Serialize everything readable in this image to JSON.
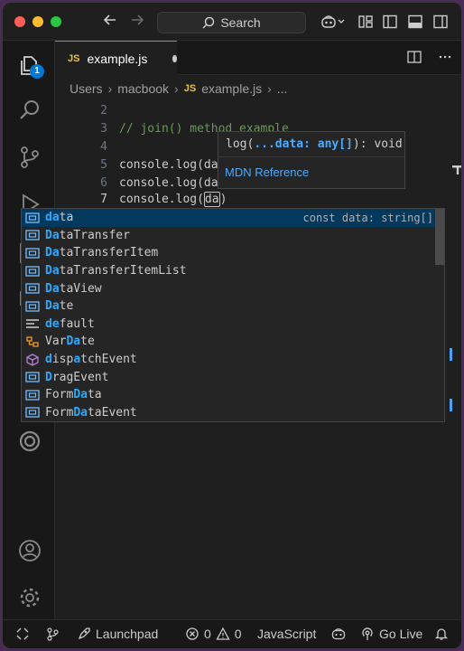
{
  "titlebar": {
    "search_label": "Search",
    "back_icon": "arrow-left-icon",
    "forward_icon": "arrow-right-icon"
  },
  "activity": {
    "explorer_badge": "1"
  },
  "tab": {
    "js_badge": "JS",
    "filename": "example.js"
  },
  "breadcrumb": {
    "items": [
      "Users",
      "macbook",
      "example.js",
      "..."
    ],
    "js_badge": "JS"
  },
  "editor": {
    "lines": [
      {
        "num": "2",
        "text": ""
      },
      {
        "num": "3",
        "text": "// join() method example"
      },
      {
        "num": "4",
        "text": ""
      },
      {
        "num": "5",
        "text": "console.log(da"
      },
      {
        "num": "6",
        "text": "console.log(da"
      },
      {
        "num": "7",
        "text": "console.log(da)"
      }
    ]
  },
  "signature": {
    "prefix": "log(",
    "param": "...data: any[]",
    "suffix": "): void",
    "link": "MDN Reference"
  },
  "suggestions": [
    {
      "pre": "",
      "hl": "da",
      "post": "ta",
      "icon": "variable-icon",
      "detail": "const data: string[]",
      "selected": true
    },
    {
      "pre": "",
      "hl": "Da",
      "post": "taTransfer",
      "icon": "variable-icon"
    },
    {
      "pre": "",
      "hl": "Da",
      "post": "taTransferItem",
      "icon": "variable-icon"
    },
    {
      "pre": "",
      "hl": "Da",
      "post": "taTransferItemList",
      "icon": "variable-icon"
    },
    {
      "pre": "",
      "hl": "Da",
      "post": "taView",
      "icon": "variable-icon"
    },
    {
      "pre": "",
      "hl": "Da",
      "post": "te",
      "icon": "variable-icon"
    },
    {
      "pre": "",
      "hl": "de",
      "post": "fault",
      "icon": "keyword-icon"
    },
    {
      "pre": "Var",
      "hl": "Da",
      "post": "te",
      "icon": "snippet-icon"
    },
    {
      "pre": "",
      "hl": "d",
      "post": "ispatchEvent",
      "icon": "method-icon",
      "hl2": "a",
      "post2": "tchEvent",
      "pre2": "disp"
    },
    {
      "pre": "",
      "hl": "D",
      "post": "ragEvent",
      "icon": "variable-icon"
    },
    {
      "pre": "Form",
      "hl": "Da",
      "post": "ta",
      "icon": "variable-icon"
    },
    {
      "pre": "Form",
      "hl": "Da",
      "post": "taEvent",
      "icon": "variable-icon"
    }
  ],
  "statusbar": {
    "launchpad": "Launchpad",
    "errors": "0",
    "warnings": "0",
    "language": "JavaScript",
    "golive": "Go Live"
  }
}
